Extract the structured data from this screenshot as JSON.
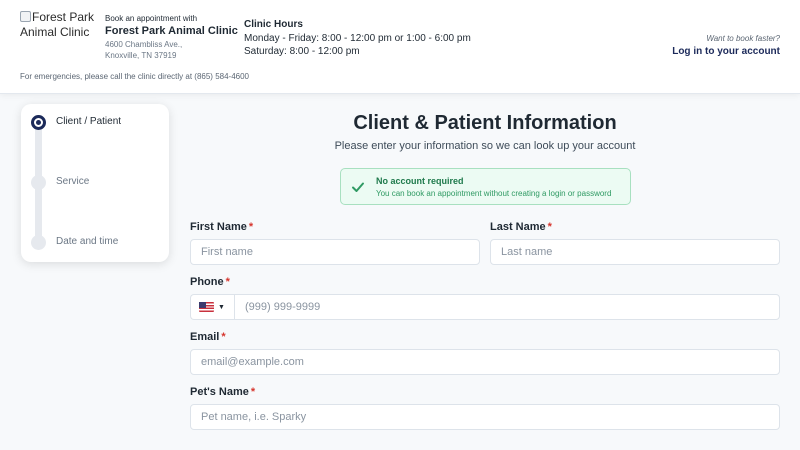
{
  "header": {
    "logo_alt": "Forest Park Animal Clinic",
    "book_with": "Book an appointment with",
    "clinic_name": "Forest Park Animal Clinic",
    "address_line1": "4600 Chambliss Ave.,",
    "address_line2": "Knoxville, TN 37919",
    "hours_title": "Clinic Hours",
    "hours_weekday": "Monday - Friday: 8:00 - 12:00 pm or 1:00 - 6:00 pm",
    "hours_saturday": "Saturday: 8:00 - 12:00 pm",
    "emergency": "For emergencies, please call the clinic directly at (865) 584-4600",
    "faster": "Want to book faster?",
    "login": "Log in to your account"
  },
  "stepper": {
    "steps": [
      {
        "label": "Client / Patient",
        "active": true
      },
      {
        "label": "Service",
        "active": false
      },
      {
        "label": "Date and time",
        "active": false
      }
    ]
  },
  "form": {
    "title": "Client & Patient Information",
    "subtitle": "Please enter your information so we can look up your account",
    "notice": {
      "title": "No account required",
      "text": "You can book an appointment without creating a login or password"
    },
    "required_mark": "*",
    "first_name": {
      "label": "First Name",
      "placeholder": "First name",
      "value": ""
    },
    "last_name": {
      "label": "Last Name",
      "placeholder": "Last name",
      "value": ""
    },
    "phone": {
      "label": "Phone",
      "placeholder": "(999) 999-9999",
      "value": "",
      "country_icon": "us-flag-icon"
    },
    "email": {
      "label": "Email",
      "placeholder": "email@example.com",
      "value": ""
    },
    "pet_name": {
      "label": "Pet's Name",
      "placeholder": "Pet name, i.e. Sparky",
      "value": ""
    }
  },
  "colors": {
    "accent": "#1c2a5a",
    "required": "#d6352d",
    "success_bg": "#ecfbf3",
    "success_border": "#a8e0c0",
    "success_text": "#1f7a4c"
  }
}
